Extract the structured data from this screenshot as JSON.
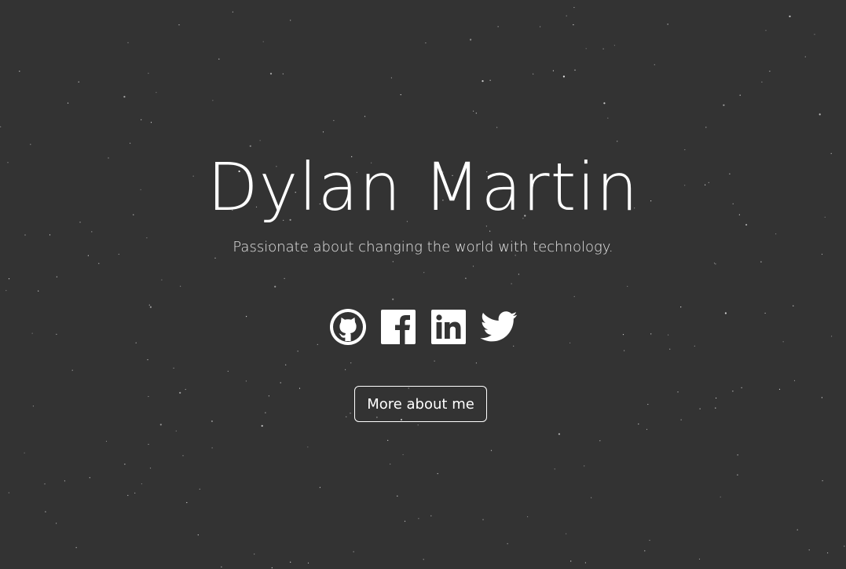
{
  "hero": {
    "name": "Dylan Martin",
    "tagline": "Passionate about changing the world with technology."
  },
  "social_links": [
    {
      "icon": "github-icon"
    },
    {
      "icon": "facebook-icon"
    },
    {
      "icon": "linkedin-icon"
    },
    {
      "icon": "twitter-icon"
    }
  ],
  "cta": {
    "label": "More about me"
  },
  "colors": {
    "background": "#333333",
    "text": "#ffffff",
    "star": "#ffffff"
  }
}
